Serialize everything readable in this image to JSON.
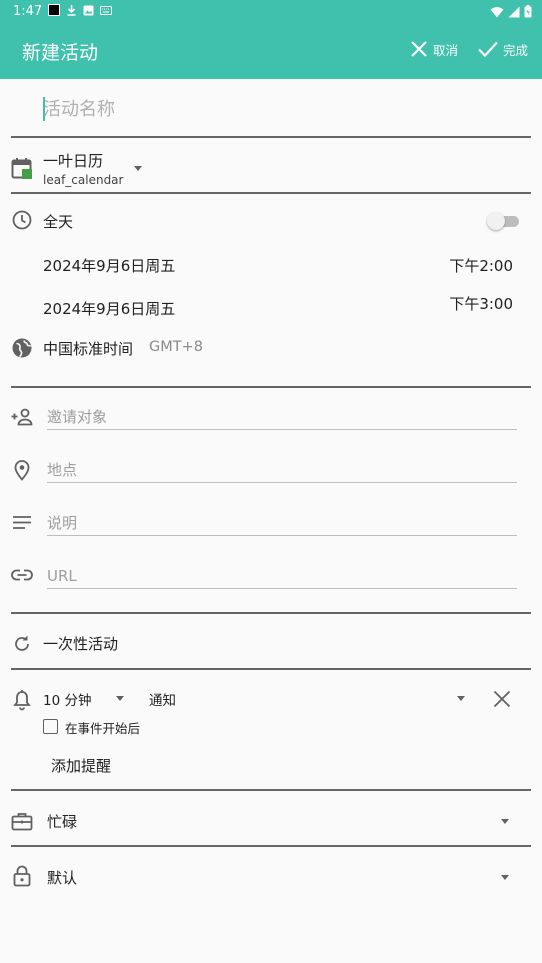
{
  "status_bar": {
    "time": "1:47"
  },
  "app_bar": {
    "title": "新建活动",
    "cancel_label": "取消",
    "done_label": "完成"
  },
  "event_name": {
    "placeholder": "活动名称",
    "value": ""
  },
  "calendar": {
    "name": "一叶日历",
    "account": "leaf_calendar",
    "color": "#43a047"
  },
  "all_day": {
    "label": "全天",
    "enabled": false
  },
  "start": {
    "date": "2024年9月6日周五",
    "time": "下午2:00"
  },
  "end": {
    "date": "2024年9月6日周五",
    "time": "下午3:00"
  },
  "timezone": {
    "name": "中国标准时间",
    "offset": "GMT+8"
  },
  "attendees": {
    "placeholder": "邀请对象"
  },
  "location": {
    "placeholder": "地点"
  },
  "description": {
    "placeholder": "说明"
  },
  "url": {
    "placeholder": "URL"
  },
  "repeat": {
    "label": "一次性活动"
  },
  "reminder": {
    "minutes": "10 分钟",
    "method": "通知",
    "after_start_label": "在事件开始后",
    "after_start_checked": false,
    "add_label": "添加提醒"
  },
  "availability": {
    "label": "忙碌"
  },
  "visibility": {
    "label": "默认"
  },
  "colors": {
    "accent": "#3fc1ad",
    "divider": "#666666",
    "icon": "#616161"
  }
}
